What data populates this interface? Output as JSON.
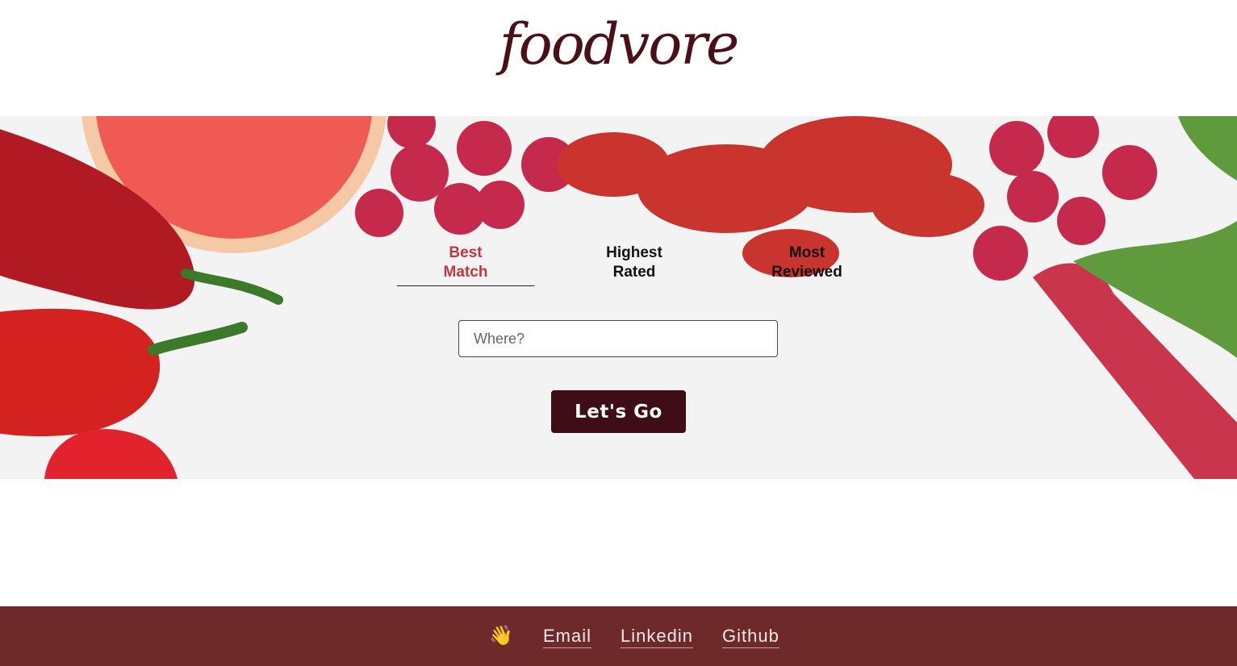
{
  "header": {
    "logo_text": "foodvore"
  },
  "tabs": [
    {
      "label_line1": "Best",
      "label_line2": "Match",
      "active": true
    },
    {
      "label_line1": "Highest",
      "label_line2": "Rated",
      "active": false
    },
    {
      "label_line1": "Most",
      "label_line2": "Reviewed",
      "active": false
    }
  ],
  "search": {
    "placeholder": "Where?",
    "value": ""
  },
  "submit": {
    "label": "Let's Go"
  },
  "footer": {
    "wave_icon": "waving-hand-icon",
    "wave_emoji": "👋",
    "links": [
      {
        "label": "Email"
      },
      {
        "label": "Linkedin"
      },
      {
        "label": "Github"
      }
    ]
  },
  "colors": {
    "brand_dark": "#3e0d15",
    "logo": "#4a1019",
    "active_tab": "#c2363e",
    "footer_bg": "#6e292a"
  }
}
